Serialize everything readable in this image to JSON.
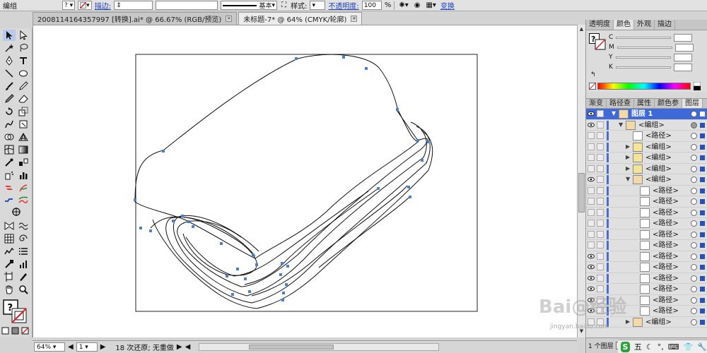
{
  "control_bar": {
    "selection_label": "编组",
    "stroke_label": "描边:",
    "style_preset": "基本",
    "style_label": "样式:",
    "opacity_label": "不透明度:",
    "opacity_value": "100",
    "opacity_unit": "%",
    "transform_link": "变换"
  },
  "tabs": [
    {
      "label": "2008114164357997  [转换].ai* @ 66.67% (RGB/预览)",
      "active": false
    },
    {
      "label": "未标题-7* @ 64% (CMYK/轮廓)",
      "active": true
    }
  ],
  "status_bar": {
    "zoom": "64%",
    "page": "1",
    "history": "18 次还原; 无重做"
  },
  "color_panel": {
    "tabs": [
      "透明度",
      "颜色",
      "外观",
      "描边"
    ],
    "active_tab": "颜色",
    "channels": [
      "C",
      "M",
      "Y",
      "K"
    ]
  },
  "layers_panel": {
    "tabs": [
      "渐变",
      "路径查",
      "属性",
      "颜色参",
      "图层"
    ],
    "active_tab": "图层",
    "layer_name": "图层 1",
    "rows": [
      {
        "name": "<编组>",
        "indent": 1,
        "expanded": true,
        "eye": true
      },
      {
        "name": "<路径>",
        "indent": 2,
        "expanded": false,
        "eye": false
      },
      {
        "name": "<编组>",
        "indent": 2,
        "expanded": false,
        "eye": false
      },
      {
        "name": "<编组>",
        "indent": 2,
        "expanded": false,
        "eye": false
      },
      {
        "name": "<编组>",
        "indent": 2,
        "expanded": false,
        "eye": false
      },
      {
        "name": "<编组>",
        "indent": 2,
        "expanded": true,
        "eye": true
      },
      {
        "name": "<路径>",
        "indent": 3,
        "expanded": false,
        "eye": false
      },
      {
        "name": "<路径>",
        "indent": 3,
        "expanded": false,
        "eye": false
      },
      {
        "name": "<路径>",
        "indent": 3,
        "expanded": false,
        "eye": false
      },
      {
        "name": "<路径>",
        "indent": 3,
        "expanded": false,
        "eye": false
      },
      {
        "name": "<路径>",
        "indent": 3,
        "expanded": false,
        "eye": false
      },
      {
        "name": "<路径>",
        "indent": 3,
        "expanded": false,
        "eye": false
      },
      {
        "name": "<路径>",
        "indent": 3,
        "expanded": false,
        "eye": true
      },
      {
        "name": "<路径>",
        "indent": 3,
        "expanded": false,
        "eye": true
      },
      {
        "name": "<路径>",
        "indent": 3,
        "expanded": false,
        "eye": true
      },
      {
        "name": "<路径>",
        "indent": 3,
        "expanded": false,
        "eye": true
      },
      {
        "name": "<路径>",
        "indent": 3,
        "expanded": false,
        "eye": true
      },
      {
        "name": "<路径>",
        "indent": 3,
        "expanded": false,
        "eye": true
      },
      {
        "name": "<编组>",
        "indent": 2,
        "expanded": false,
        "eye": false
      }
    ],
    "footer": "1 个图层"
  },
  "ime": {
    "logo": "S",
    "label": "五"
  },
  "watermark": {
    "text": "Bai@经验",
    "url": "jingyan.baidu.com"
  },
  "colors": {
    "accent": "#3d6ad8",
    "anchor_point": "#4a7fd6",
    "layer_color_bar": "#4a6ed0",
    "canvas": "#ffffff",
    "chrome": "#d4d4d4"
  }
}
